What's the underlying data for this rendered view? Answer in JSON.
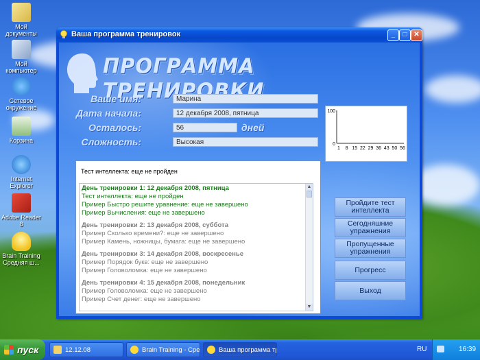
{
  "desktop": {
    "icons": [
      {
        "label": "Мой документы"
      },
      {
        "label": "Мой компьютер"
      },
      {
        "label": "Сетевое окружение"
      },
      {
        "label": "Корзина"
      },
      {
        "label": "Internet Explorer"
      },
      {
        "label": "Adobe Reader 8"
      },
      {
        "label": "Brain Training Средняя ш..."
      }
    ]
  },
  "window": {
    "title": "Ваша программа тренировок",
    "brand": "ПРОГРАММА ТРЕНИРОВКИ",
    "fields": {
      "name": {
        "label": "Ваше имя:",
        "value": "Марина"
      },
      "start_date": {
        "label": "Дата начала:",
        "value": "12 декабря 2008, пятница"
      },
      "remaining": {
        "label": "Осталось:",
        "value": "56",
        "unit": "дней"
      },
      "difficulty": {
        "label": "Сложность:",
        "value": "Высокая"
      }
    },
    "chart_data": {
      "type": "line",
      "y_ticks": [
        "100",
        "0"
      ],
      "x_ticks": [
        "1",
        "8",
        "15",
        "22",
        "29",
        "36",
        "43",
        "50",
        "56"
      ]
    },
    "status_text": "Тест интеллекта: еще не пройден",
    "log": [
      {
        "day": "День тренировки 1: 12 декабря 2008, пятница",
        "color": "#1f7a1f",
        "items": [
          "Тест интеллекта: еще не пройден",
          "Пример Быстро решите уравнение: еще не завершено",
          "Пример Вычисления: еще не завершено"
        ]
      },
      {
        "day": "День тренировки 2: 13 декабря 2008, суббота",
        "color": "#808080",
        "items": [
          "Пример Сколько времени?: еще не завершено",
          "Пример Камень, ножницы, бумага: еще не завершено"
        ]
      },
      {
        "day": "День тренировки 3: 14 декабря 2008, воскресенье",
        "color": "#808080",
        "items": [
          "Пример Порядок букв: еще не завершено",
          "Пример Головоломка: еще не завершено"
        ]
      },
      {
        "day": "День тренировки 4: 15 декабря 2008, понедельник",
        "color": "#808080",
        "items": [
          "Пример Головоломка: еще не завершено",
          "Пример Счет денег: еще не завершено"
        ]
      }
    ],
    "buttons": {
      "test": "Пройдите тест интеллекта",
      "today": "Сегодняшние упражнения",
      "missed": "Пропущенные упражнения",
      "progress": "Прогресс",
      "exit": "Выход"
    }
  },
  "taskbar": {
    "start": "пуск",
    "tasks": [
      "12.12.08",
      "Brain Training - Сред...",
      "Ваша программа тре..."
    ],
    "lang": "RU",
    "clock": "16:39"
  }
}
